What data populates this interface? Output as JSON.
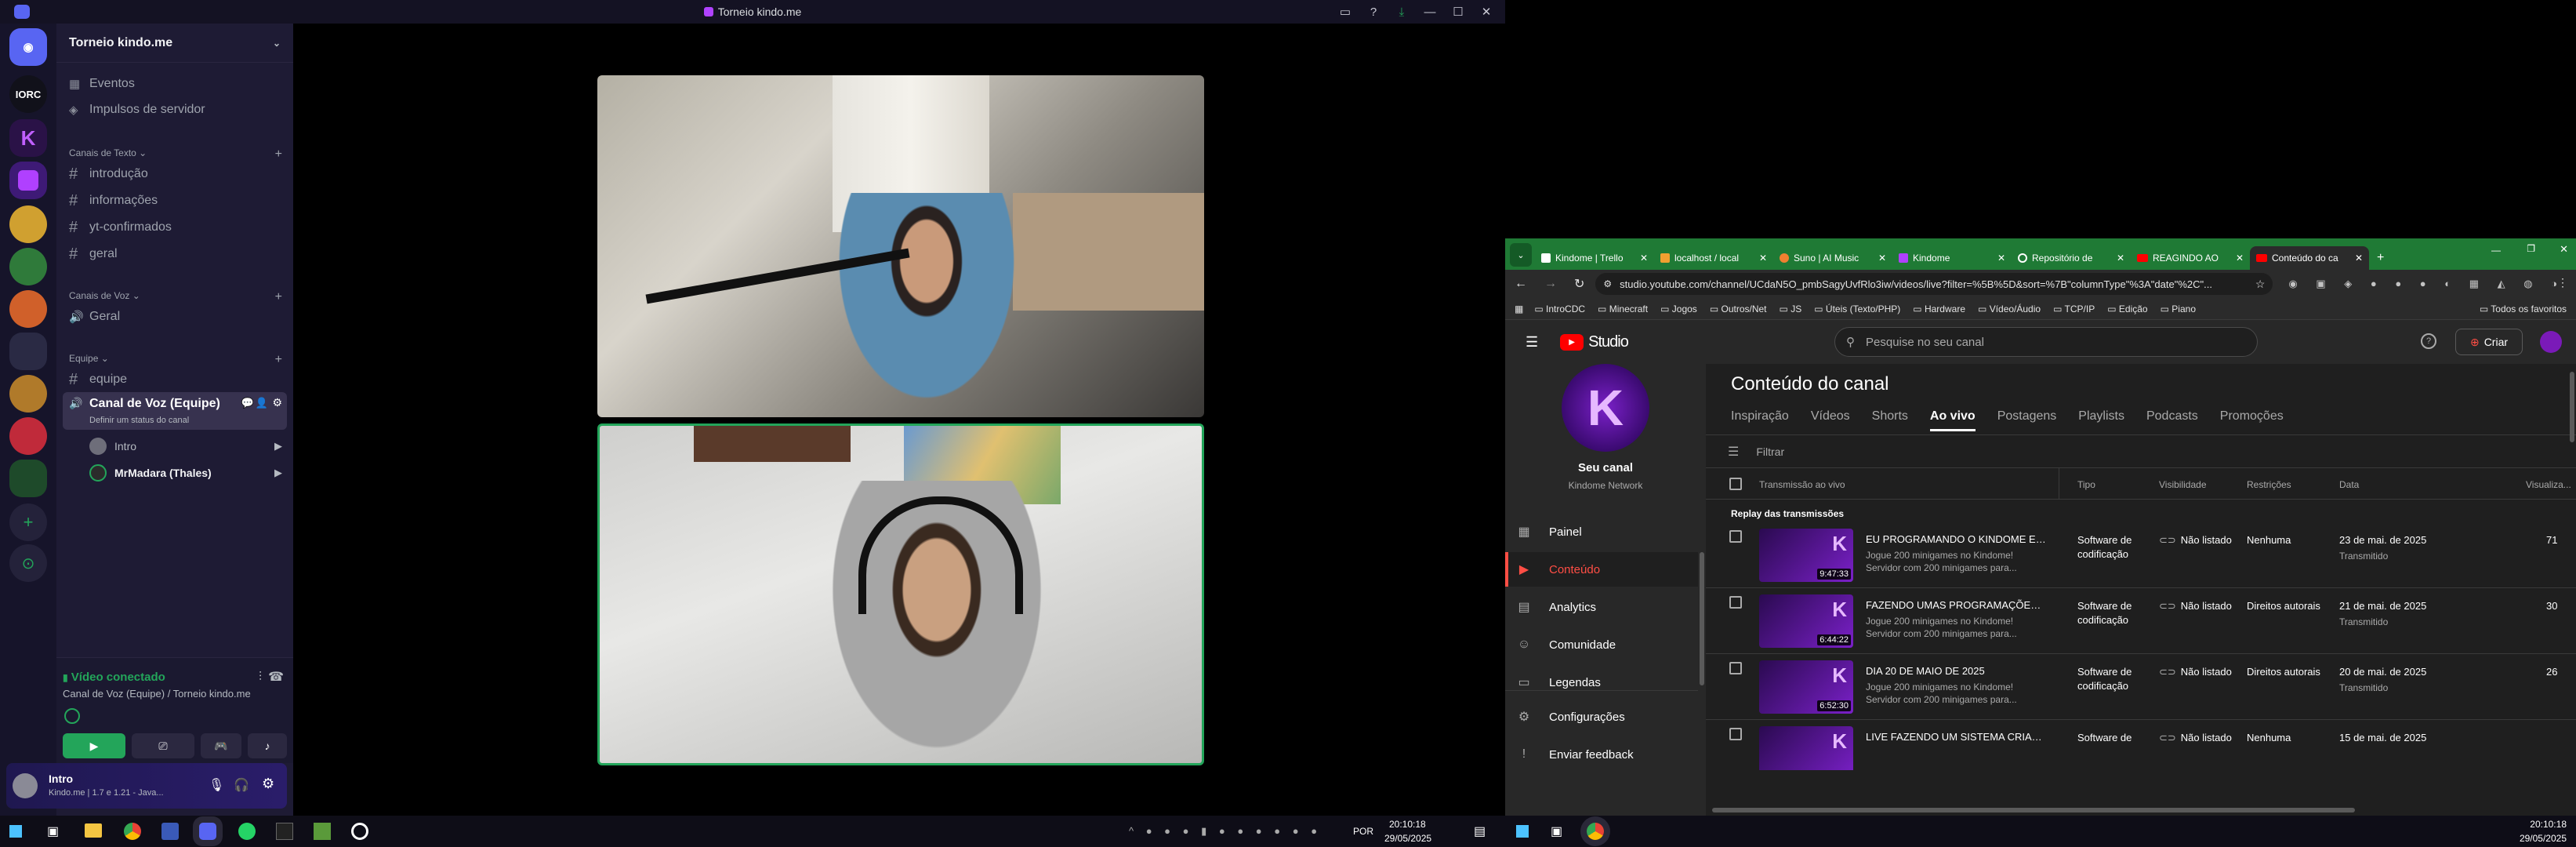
{
  "discord": {
    "window_title": "Torneio kindo.me",
    "server_name": "Torneio kindo.me",
    "top_items": [
      {
        "label": "Eventos",
        "icon": "calendar-icon"
      },
      {
        "label": "Impulsos de servidor",
        "icon": "boost-icon"
      }
    ],
    "categories": {
      "text": "Canais de Texto",
      "voice": "Canais de Voz",
      "team": "Equipe"
    },
    "text_channels": [
      "introdução",
      "informações",
      "yt-confirmados",
      "geral"
    ],
    "voice_channels": [
      "Geral"
    ],
    "team_channels": [
      "equipe"
    ],
    "active_voice_channel": "Canal de Voz (Equipe)",
    "status_prompt": "Definir um status do canal",
    "voice_members": [
      "Intro",
      "MrMadara (Thales)"
    ],
    "server_badges": [
      "IORC",
      "K"
    ],
    "connection_status": "Vídeo conectado",
    "connection_channel": "Canal de Voz (Equipe) / Torneio kindo.me",
    "user_name": "Intro",
    "user_status": "Kindo.me | 1.7 e 1.21 - Java..."
  },
  "taskbar_left": {
    "lang": "POR",
    "time": "20:10:18",
    "date": "29/05/2025"
  },
  "taskbar_right": {
    "time": "20:10:18",
    "date": "29/05/2025"
  },
  "browser": {
    "tabs": [
      {
        "label": "Kindome | Trello"
      },
      {
        "label": "localhost / local"
      },
      {
        "label": "Suno | AI Music"
      },
      {
        "label": "Kindome"
      },
      {
        "label": "Repositório de"
      },
      {
        "label": "REAGINDO AO"
      },
      {
        "label": "Conteúdo do ca"
      }
    ],
    "url": "studio.youtube.com/channel/UCdaN5O_pmbSagyUvfRlo3iw/videos/live?filter=%5B%5D&sort=%7B\"columnType\"%3A\"date\"%2C\"...",
    "bookmarks": [
      "IntroCDC",
      "Minecraft",
      "Jogos",
      "Outros/Net",
      "JS",
      "Úteis (Texto/PHP)",
      "Hardware",
      "Vídeo/Áudio",
      "TCP/IP",
      "Edição",
      "Piano"
    ],
    "all_bookmarks": "Todos os favoritos"
  },
  "studio": {
    "logo": "Studio",
    "search_placeholder": "Pesquise no seu canal",
    "create_label": "Criar",
    "channel_label": "Seu canal",
    "channel_name": "Kindome Network",
    "nav": [
      {
        "label": "Painel",
        "icon": "dashboard-icon"
      },
      {
        "label": "Conteúdo",
        "icon": "content-icon"
      },
      {
        "label": "Analytics",
        "icon": "analytics-icon"
      },
      {
        "label": "Comunidade",
        "icon": "community-icon"
      },
      {
        "label": "Legendas",
        "icon": "subtitles-icon"
      },
      {
        "label": "Configurações",
        "icon": "settings-icon"
      },
      {
        "label": "Enviar feedback",
        "icon": "feedback-icon"
      }
    ],
    "page_title": "Conteúdo do canal",
    "tabs": [
      "Inspiração",
      "Vídeos",
      "Shorts",
      "Ao vivo",
      "Postagens",
      "Playlists",
      "Podcasts",
      "Promoções"
    ],
    "active_tab": "Ao vivo",
    "filter_placeholder": "Filtrar",
    "columns": [
      "Transmissão ao vivo",
      "Tipo",
      "Visibilidade",
      "Restrições",
      "Data",
      "Visualiza..."
    ],
    "section_label": "Replay das transmissões",
    "rows": [
      {
        "title": "EU PROGRAMANDO O KINDOME E OU...",
        "desc1": "Jogue 200 minigames no Kindome!",
        "desc2": "Servidor com 200 minigames para...",
        "duration": "9:47:33",
        "type": "Software de codificação",
        "visibility": "Não listado",
        "restriction": "Nenhuma",
        "date": "23 de mai. de 2025",
        "date_sub": "Transmitido",
        "views": "71"
      },
      {
        "title": "FAZENDO UMAS PROGRAMAÇÕES AL...",
        "desc1": "Jogue 200 minigames no Kindome!",
        "desc2": "Servidor com 200 minigames para...",
        "duration": "6:44:22",
        "type": "Software de codificação",
        "visibility": "Não listado",
        "restriction": "Direitos autorais",
        "date": "21 de mai. de 2025",
        "date_sub": "Transmitido",
        "views": "30"
      },
      {
        "title": "DIA 20 DE MAIO DE 2025",
        "desc1": "Jogue 200 minigames no Kindome!",
        "desc2": "Servidor com 200 minigames para...",
        "duration": "6:52:30",
        "type": "Software de codificação",
        "visibility": "Não listado",
        "restriction": "Direitos autorais",
        "date": "20 de mai. de 2025",
        "date_sub": "Transmitido",
        "views": "26"
      },
      {
        "title": "LIVE FAZENDO UM SISTEMA CRIADO...",
        "desc1": "",
        "desc2": "",
        "duration": "",
        "type": "Software de",
        "visibility": "Não listado",
        "restriction": "Nenhuma",
        "date": "15 de mai. de 2025",
        "date_sub": "",
        "views": ""
      }
    ]
  }
}
